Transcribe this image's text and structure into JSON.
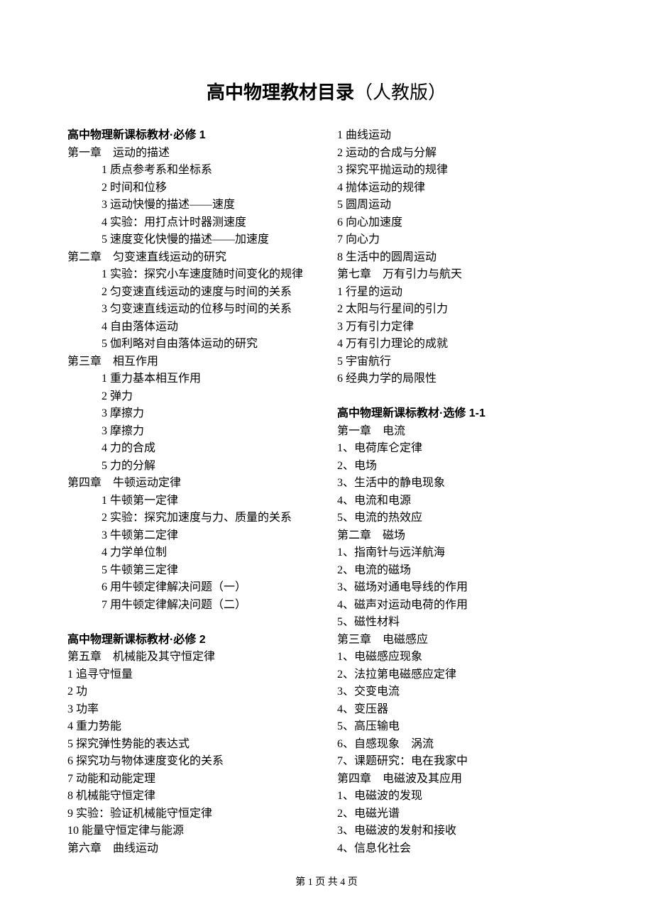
{
  "title": "高中物理教材目录",
  "subtitle": "（人教版）",
  "left": {
    "book1_header": "高中物理新课标教材·必修 1",
    "ch1": "第一章　运动的描述",
    "ch1_items": [
      "1 质点参考系和坐标系",
      "2 时间和位移",
      "3 运动快慢的描述——速度",
      "4 实验：用打点计时器测速度",
      "5 速度变化快慢的描述——加速度"
    ],
    "ch2": "第二章　匀变速直线运动的研究",
    "ch2_items": [
      "1 实验：探究小车速度随时间变化的规律",
      "2 匀变速直线运动的速度与时间的关系",
      "3 匀变速直线运动的位移与时间的关系",
      "4 自由落体运动",
      "5 伽利略对自由落体运动的研究"
    ],
    "ch3": "第三章　相互作用",
    "ch3_items": [
      "1 重力基本相互作用",
      "2 弹力",
      "3 摩擦力",
      "3 摩擦力",
      "4 力的合成",
      "5 力的分解"
    ],
    "ch4": "第四章　牛顿运动定律",
    "ch4_items": [
      "1 牛顿第一定律",
      "2 实验：探究加速度与力、质量的关系",
      "3 牛顿第二定律",
      "4 力学单位制",
      "5 牛顿第三定律",
      "6 用牛顿定律解决问题（一）",
      "7 用牛顿定律解决问题（二）"
    ],
    "book2_header": "高中物理新课标教材·必修 2",
    "ch5": "第五章　机械能及其守恒定律",
    "ch5_items": [
      "1 追寻守恒量",
      "2 功",
      "3 功率",
      "4 重力势能",
      "5 探究弹性势能的表达式",
      "6 探究功与物体速度变化的关系",
      "7 动能和动能定理",
      "8 机械能守恒定律",
      "9 实验：验证机械能守恒定律",
      "10 能量守恒定律与能源"
    ],
    "ch6": "第六章　曲线运动"
  },
  "right": {
    "ch6_items": [
      "1 曲线运动",
      "2 运动的合成与分解",
      "3 探究平抛运动的规律",
      "4 抛体运动的规律",
      "5 圆周运动",
      "6 向心加速度",
      "7 向心力",
      "8 生活中的圆周运动"
    ],
    "ch7": "第七章　万有引力与航天",
    "ch7_items": [
      "1 行星的运动",
      "2 太阳与行星间的引力",
      "3 万有引力定律",
      "4 万有引力理论的成就",
      "5 宇宙航行",
      "6 经典力学的局限性"
    ],
    "book3_header": "高中物理新课标教材·选修 1-1",
    "e_ch1": "第一章　电流",
    "e_ch1_items": [
      "1、电荷库仑定律",
      "2、电场",
      "3、生活中的静电现象",
      "4、电流和电源",
      "5、电流的热效应"
    ],
    "e_ch2": "第二章　磁场",
    "e_ch2_items": [
      "1、指南针与远洋航海",
      "2、电流的磁场",
      "3、磁场对通电导线的作用",
      "4、磁声对运动电荷的作用",
      "5、磁性材料"
    ],
    "e_ch3": "第三章　电磁感应",
    "e_ch3_items": [
      "1、电磁感应现象",
      "2、法拉第电磁感应定律",
      "3、交变电流",
      "4、变压器",
      "5、高压输电",
      "6、自感现象　涡流",
      "7、课题研究：电在我家中"
    ],
    "e_ch4": "第四章　电磁波及其应用",
    "e_ch4_items": [
      "1、电磁波的发现",
      "2、电磁光谱",
      "3、电磁波的发射和接收",
      "4、信息化社会"
    ]
  },
  "footer": "第 1 页 共 4 页"
}
